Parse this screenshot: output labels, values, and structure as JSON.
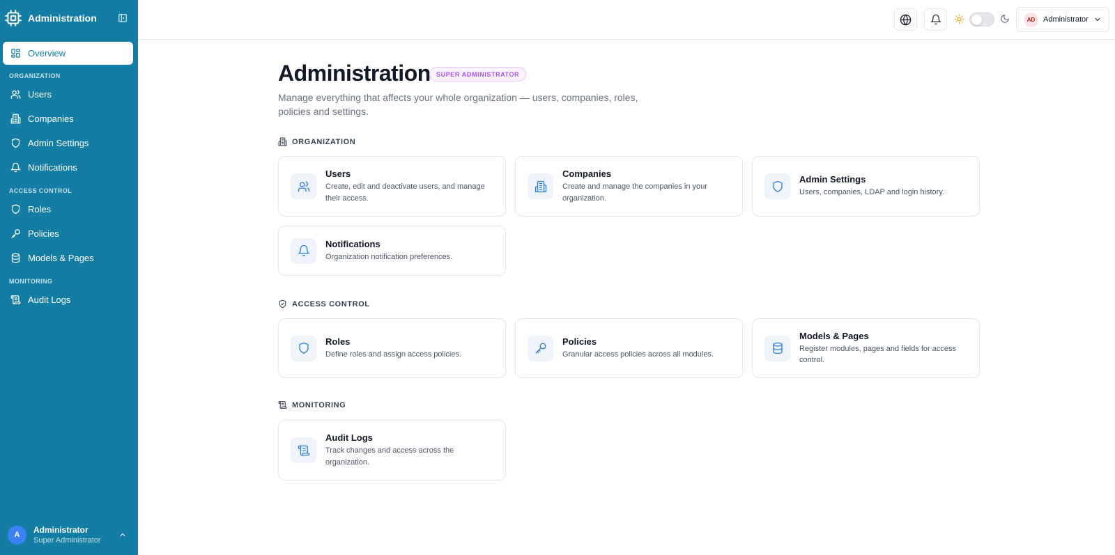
{
  "sidebar": {
    "title": "Administration",
    "items": [
      {
        "label": "Overview"
      },
      {
        "label": "Users"
      },
      {
        "label": "Companies"
      },
      {
        "label": "Admin Settings"
      },
      {
        "label": "Notifications"
      },
      {
        "label": "Roles"
      },
      {
        "label": "Policies"
      },
      {
        "label": "Models & Pages"
      },
      {
        "label": "Audit Logs"
      }
    ],
    "sections": [
      "ORGANIZATION",
      "ACCESS CONTROL",
      "MONITORING"
    ],
    "user": {
      "initial": "A",
      "name": "Administrator",
      "role": "Super Administrator"
    }
  },
  "topbar": {
    "user_initials": "AD",
    "user_name": "Administrator",
    "theme": "light"
  },
  "main": {
    "title": "Administration",
    "badge": "SUPER ADMINISTRATOR",
    "description": "Manage everything that affects your whole organization — users, companies, roles, policies and settings.",
    "sections": [
      {
        "heading": "ORGANIZATION",
        "cards": [
          {
            "title": "Users",
            "desc": "Create, edit and deactivate users, and manage their access."
          },
          {
            "title": "Companies",
            "desc": "Create and manage the companies in your organization."
          },
          {
            "title": "Admin Settings",
            "desc": "Users, companies, LDAP and login history."
          },
          {
            "title": "Notifications",
            "desc": "Organization notification preferences."
          }
        ]
      },
      {
        "heading": "ACCESS CONTROL",
        "cards": [
          {
            "title": "Roles",
            "desc": "Define roles and assign access policies."
          },
          {
            "title": "Policies",
            "desc": "Granular access policies across all modules."
          },
          {
            "title": "Models & Pages",
            "desc": "Register modules, pages and fields for access control."
          }
        ]
      },
      {
        "heading": "MONITORING",
        "cards": [
          {
            "title": "Audit Logs",
            "desc": "Track changes and access across the organization."
          }
        ]
      }
    ]
  },
  "colors": {
    "sidebar_bg": "#137da3",
    "icon_accent": "#2f7fd6",
    "badge_text": "#a855f7"
  }
}
